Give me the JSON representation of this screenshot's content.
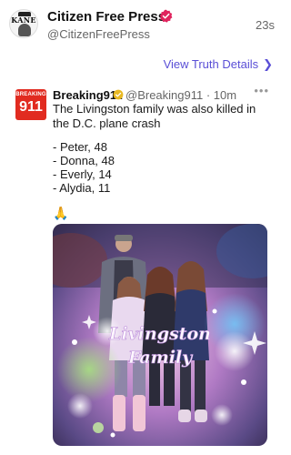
{
  "post": {
    "display_name": "Citizen Free Press",
    "handle": "@CitizenFreePress",
    "time": "23s",
    "avatar_text": "KANE"
  },
  "actions": {
    "view_details": "View Truth Details"
  },
  "quote": {
    "avatar_top": "BREAKING",
    "avatar_num": "911",
    "name": "Breaking911",
    "handle_time": "@Breaking911 · 10m",
    "text": "The Livingston family was also killed in the D.C. plane crash",
    "list": [
      "- Peter, 48",
      "- Donna, 48",
      "- Everly, 14",
      "- Alydia, 11"
    ],
    "emoji": "🙏"
  },
  "media": {
    "caption_line1": "Livingston",
    "caption_line2": "Family"
  },
  "colors": {
    "verified": "#e0245e",
    "quote_verified": "#e8b923",
    "link": "#5a4fd6",
    "breaking_red": "#e12b20"
  }
}
